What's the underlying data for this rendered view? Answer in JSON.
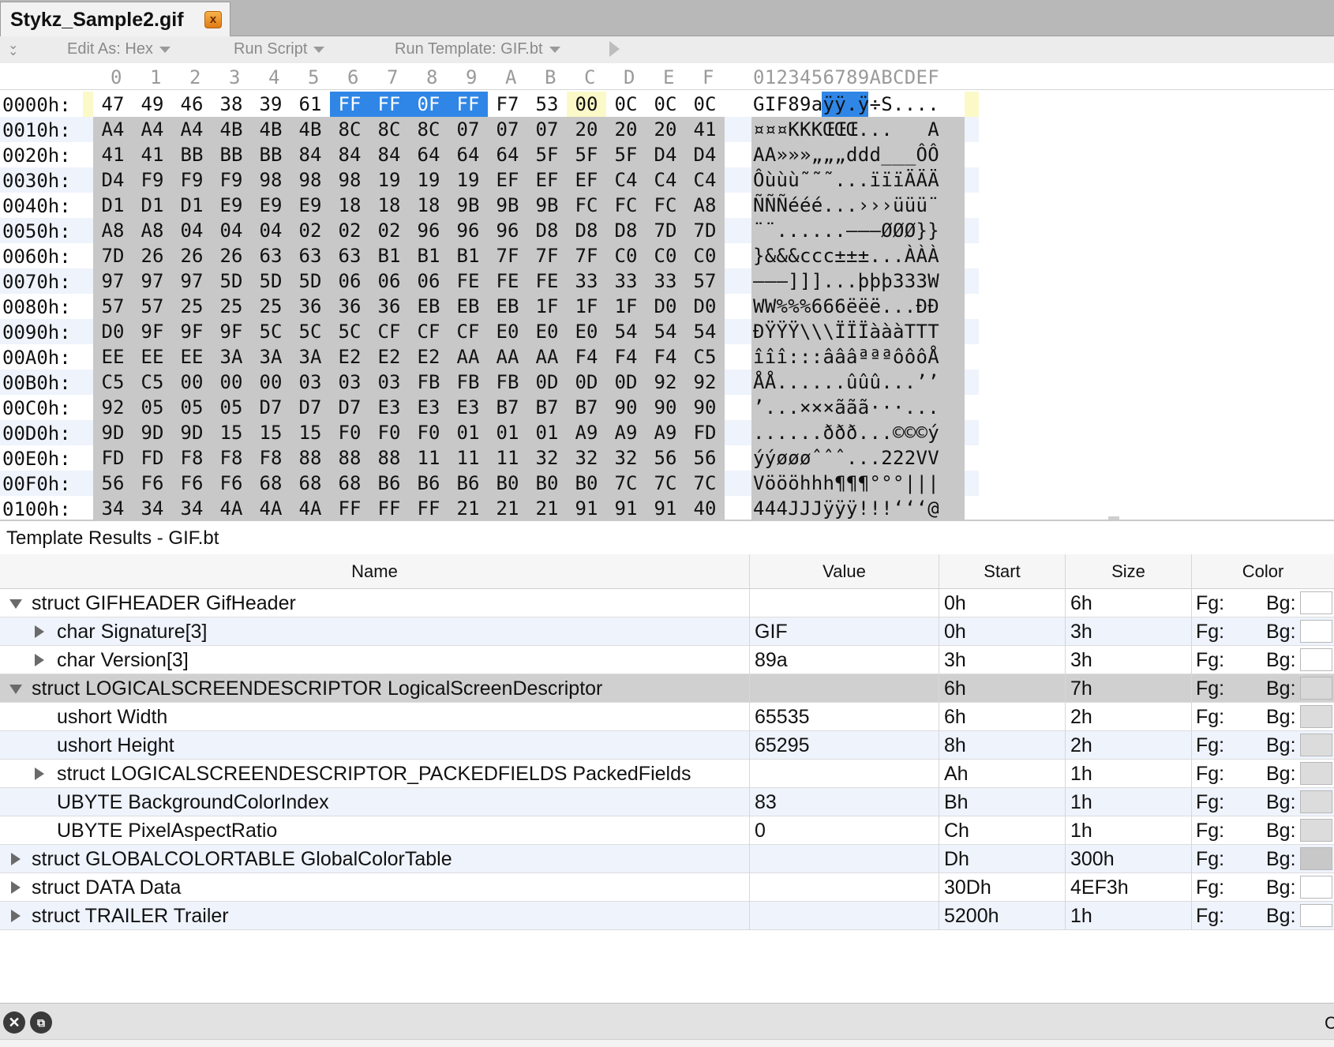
{
  "tab": {
    "title": "Stykz_Sample2.gif",
    "close_glyph": "x"
  },
  "toolbar": {
    "edit_as": "Edit As: Hex",
    "run_script": "Run Script",
    "run_template": "Run Template: GIF.bt"
  },
  "hex": {
    "column_headers": [
      "0",
      "1",
      "2",
      "3",
      "4",
      "5",
      "6",
      "7",
      "8",
      "9",
      "A",
      "B",
      "C",
      "D",
      "E",
      "F"
    ],
    "ascii_header": "0123456789ABCDEF",
    "selected_offsets": [
      6,
      7,
      8,
      9
    ],
    "rows": [
      {
        "addr": "0000h:",
        "bytes": [
          "47",
          "49",
          "46",
          "38",
          "39",
          "61",
          "FF",
          "FF",
          "0F",
          "FF",
          "F7",
          "53",
          "00",
          "0C",
          "0C",
          "0C"
        ],
        "ascii": "GIF89aÿÿ.ÿ÷S...."
      },
      {
        "addr": "0010h:",
        "bytes": [
          "A4",
          "A4",
          "A4",
          "4B",
          "4B",
          "4B",
          "8C",
          "8C",
          "8C",
          "07",
          "07",
          "07",
          "20",
          "20",
          "20",
          "41"
        ],
        "ascii": "¤¤¤KKKŒŒŒ...   A"
      },
      {
        "addr": "0020h:",
        "bytes": [
          "41",
          "41",
          "BB",
          "BB",
          "BB",
          "84",
          "84",
          "84",
          "64",
          "64",
          "64",
          "5F",
          "5F",
          "5F",
          "D4",
          "D4"
        ],
        "ascii": "AA»»»„„„ddd___ÔÔ"
      },
      {
        "addr": "0030h:",
        "bytes": [
          "D4",
          "F9",
          "F9",
          "F9",
          "98",
          "98",
          "98",
          "19",
          "19",
          "19",
          "EF",
          "EF",
          "EF",
          "C4",
          "C4",
          "C4"
        ],
        "ascii": "Ôùùù˜˜˜...ïïïÄÄÄ"
      },
      {
        "addr": "0040h:",
        "bytes": [
          "D1",
          "D1",
          "D1",
          "E9",
          "E9",
          "E9",
          "18",
          "18",
          "18",
          "9B",
          "9B",
          "9B",
          "FC",
          "FC",
          "FC",
          "A8"
        ],
        "ascii": "ÑÑÑééé...›››üüü¨"
      },
      {
        "addr": "0050h:",
        "bytes": [
          "A8",
          "A8",
          "04",
          "04",
          "04",
          "02",
          "02",
          "02",
          "96",
          "96",
          "96",
          "D8",
          "D8",
          "D8",
          "7D",
          "7D"
        ],
        "ascii": "¨¨......–––ØØØ}}"
      },
      {
        "addr": "0060h:",
        "bytes": [
          "7D",
          "26",
          "26",
          "26",
          "63",
          "63",
          "63",
          "B1",
          "B1",
          "B1",
          "7F",
          "7F",
          "7F",
          "C0",
          "C0",
          "C0"
        ],
        "ascii": "}&&&ccc±±±...ÀÀÀ"
      },
      {
        "addr": "0070h:",
        "bytes": [
          "97",
          "97",
          "97",
          "5D",
          "5D",
          "5D",
          "06",
          "06",
          "06",
          "FE",
          "FE",
          "FE",
          "33",
          "33",
          "33",
          "57"
        ],
        "ascii": "———]]]...þþþ333W"
      },
      {
        "addr": "0080h:",
        "bytes": [
          "57",
          "57",
          "25",
          "25",
          "25",
          "36",
          "36",
          "36",
          "EB",
          "EB",
          "EB",
          "1F",
          "1F",
          "1F",
          "D0",
          "D0"
        ],
        "ascii": "WW%%%666ëëë...ÐÐ"
      },
      {
        "addr": "0090h:",
        "bytes": [
          "D0",
          "9F",
          "9F",
          "9F",
          "5C",
          "5C",
          "5C",
          "CF",
          "CF",
          "CF",
          "E0",
          "E0",
          "E0",
          "54",
          "54",
          "54"
        ],
        "ascii": "ÐŸŸŸ\\\\\\ÏÏÏàààTTT"
      },
      {
        "addr": "00A0h:",
        "bytes": [
          "EE",
          "EE",
          "EE",
          "3A",
          "3A",
          "3A",
          "E2",
          "E2",
          "E2",
          "AA",
          "AA",
          "AA",
          "F4",
          "F4",
          "F4",
          "C5"
        ],
        "ascii": "îîî:::âââªªªôôôÅ"
      },
      {
        "addr": "00B0h:",
        "bytes": [
          "C5",
          "C5",
          "00",
          "00",
          "00",
          "03",
          "03",
          "03",
          "FB",
          "FB",
          "FB",
          "0D",
          "0D",
          "0D",
          "92",
          "92"
        ],
        "ascii": "ÅÅ......ûûû...’’"
      },
      {
        "addr": "00C0h:",
        "bytes": [
          "92",
          "05",
          "05",
          "05",
          "D7",
          "D7",
          "D7",
          "E3",
          "E3",
          "E3",
          "B7",
          "B7",
          "B7",
          "90",
          "90",
          "90"
        ],
        "ascii": "’...×××ããã···..."
      },
      {
        "addr": "00D0h:",
        "bytes": [
          "9D",
          "9D",
          "9D",
          "15",
          "15",
          "15",
          "F0",
          "F0",
          "F0",
          "01",
          "01",
          "01",
          "A9",
          "A9",
          "A9",
          "FD"
        ],
        "ascii": "......ððð...©©©ý"
      },
      {
        "addr": "00E0h:",
        "bytes": [
          "FD",
          "FD",
          "F8",
          "F8",
          "F8",
          "88",
          "88",
          "88",
          "11",
          "11",
          "11",
          "32",
          "32",
          "32",
          "56",
          "56"
        ],
        "ascii": "ýýøøøˆˆˆ...222VV"
      },
      {
        "addr": "00F0h:",
        "bytes": [
          "56",
          "F6",
          "F6",
          "F6",
          "68",
          "68",
          "68",
          "B6",
          "B6",
          "B6",
          "B0",
          "B0",
          "B0",
          "7C",
          "7C",
          "7C"
        ],
        "ascii": "Vöööhhh¶¶¶°°°|||"
      },
      {
        "addr": "0100h:",
        "bytes": [
          "34",
          "34",
          "34",
          "4A",
          "4A",
          "4A",
          "FF",
          "FF",
          "FF",
          "21",
          "21",
          "21",
          "91",
          "91",
          "91",
          "40"
        ],
        "ascii": "444JJJÿÿÿ!!!‘‘‘@"
      }
    ]
  },
  "template": {
    "title": "Template Results - GIF.bt",
    "columns": {
      "name": "Name",
      "value": "Value",
      "start": "Start",
      "size": "Size",
      "color": "Color"
    },
    "fg_label": "Fg:",
    "bg_label": "Bg:",
    "rows": [
      {
        "name": "struct GIFHEADER GifHeader",
        "value": "",
        "start": "0h",
        "size": "6h",
        "indent": 0,
        "expander": "open",
        "bg": "#ffffff"
      },
      {
        "name": "char Signature[3]",
        "value": "GIF",
        "start": "0h",
        "size": "3h",
        "indent": 1,
        "expander": "closed",
        "bg": "#ffffff"
      },
      {
        "name": "char Version[3]",
        "value": "89a",
        "start": "3h",
        "size": "3h",
        "indent": 1,
        "expander": "closed",
        "bg": "#ffffff"
      },
      {
        "name": "struct LOGICALSCREENDESCRIPTOR LogicalScreenDescriptor",
        "value": "",
        "start": "6h",
        "size": "7h",
        "indent": 0,
        "expander": "open",
        "bg": "#d8d8d8"
      },
      {
        "name": "ushort Width",
        "value": "65535",
        "start": "6h",
        "size": "2h",
        "indent": 1,
        "expander": "none",
        "bg": "#dcdcdc"
      },
      {
        "name": "ushort Height",
        "value": "65295",
        "start": "8h",
        "size": "2h",
        "indent": 1,
        "expander": "none",
        "bg": "#dcdcdc"
      },
      {
        "name": "struct LOGICALSCREENDESCRIPTOR_PACKEDFIELDS PackedFields",
        "value": "",
        "start": "Ah",
        "size": "1h",
        "indent": 1,
        "expander": "closed",
        "bg": "#dcdcdc"
      },
      {
        "name": "UBYTE BackgroundColorIndex",
        "value": "83",
        "start": "Bh",
        "size": "1h",
        "indent": 1,
        "expander": "none",
        "bg": "#dcdcdc"
      },
      {
        "name": "UBYTE PixelAspectRatio",
        "value": "0",
        "start": "Ch",
        "size": "1h",
        "indent": 1,
        "expander": "none",
        "bg": "#dcdcdc"
      },
      {
        "name": "struct GLOBALCOLORTABLE GlobalColorTable",
        "value": "",
        "start": "Dh",
        "size": "300h",
        "indent": 0,
        "expander": "closed",
        "bg": "#c8c8c8"
      },
      {
        "name": "struct DATA Data",
        "value": "",
        "start": "30Dh",
        "size": "4EF3h",
        "indent": 0,
        "expander": "closed",
        "bg": "#ffffff"
      },
      {
        "name": "struct TRAILER Trailer",
        "value": "",
        "start": "5200h",
        "size": "1h",
        "indent": 0,
        "expander": "closed",
        "bg": "#ffffff"
      }
    ]
  },
  "bottom": {
    "right_letter": "C"
  },
  "colors": {
    "selection": "#2f86e6",
    "gray_block": "#c8c8c8",
    "yellow": "#fbf9c8"
  }
}
